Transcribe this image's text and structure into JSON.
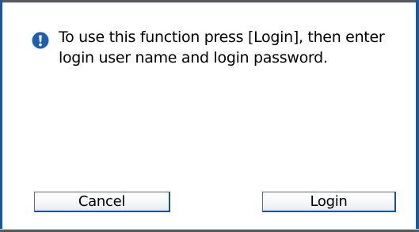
{
  "dialog": {
    "message_lines": [
      "To use this function press [Login], then enter",
      "login user name and login password."
    ],
    "icon": "exclamation-icon",
    "icon_color": "#1a5fb4",
    "buttons": {
      "cancel_label": "Cancel",
      "login_label": "Login"
    }
  }
}
